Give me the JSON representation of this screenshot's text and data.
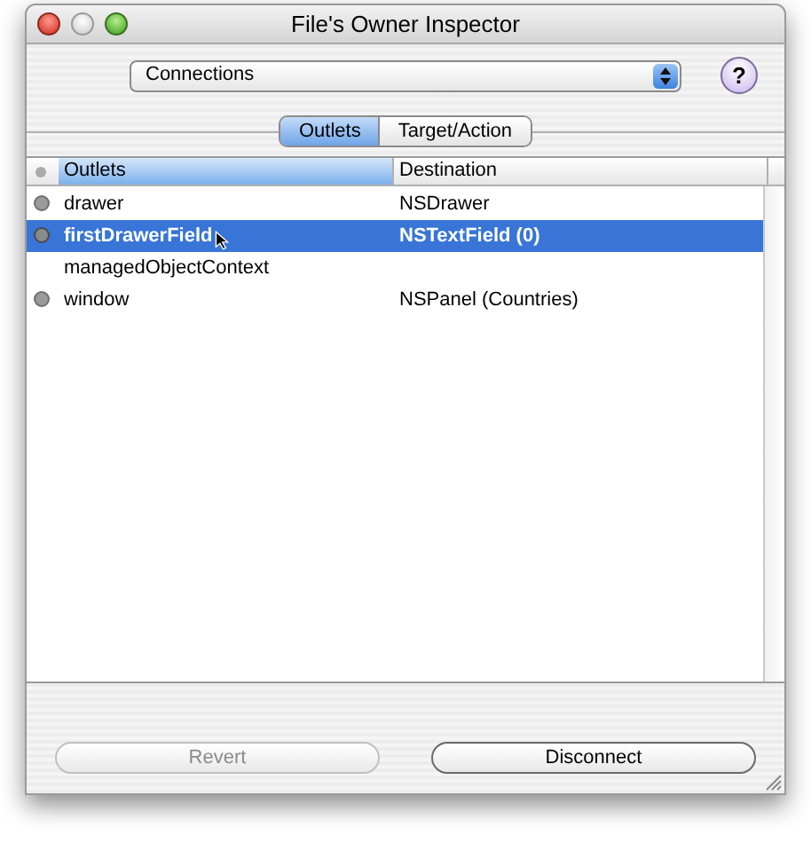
{
  "window": {
    "title": "File's Owner Inspector"
  },
  "popup": {
    "value": "Connections"
  },
  "help": {
    "label": "?"
  },
  "tabs": [
    {
      "label": "Outlets",
      "selected": true
    },
    {
      "label": "Target/Action",
      "selected": false
    }
  ],
  "table": {
    "columns": [
      {
        "label": "Outlets",
        "sorted": true
      },
      {
        "label": "Destination",
        "sorted": false
      }
    ],
    "rows": [
      {
        "outlet": "drawer",
        "destination": "NSDrawer",
        "connected": true,
        "selected": false
      },
      {
        "outlet": "firstDrawerField",
        "destination": "NSTextField (0)",
        "connected": true,
        "selected": true
      },
      {
        "outlet": "managedObjectContext",
        "connected": false,
        "selected": false
      },
      {
        "outlet": "window",
        "destination": "NSPanel (Countries)",
        "connected": true,
        "selected": false
      }
    ]
  },
  "buttons": [
    {
      "label": "Revert",
      "disabled": true
    },
    {
      "label": "Disconnect",
      "disabled": false
    }
  ]
}
